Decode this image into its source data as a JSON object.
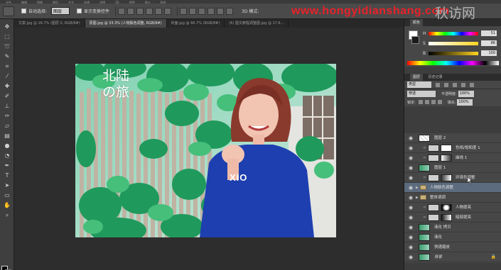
{
  "app": {
    "menu": [
      "文件",
      "编辑",
      "图像",
      "图层",
      "文字",
      "选择",
      "滤镜",
      "3D",
      "视图",
      "窗口",
      "帮助"
    ]
  },
  "options_bar": {
    "auto_select_label": "自动选择:",
    "auto_select_value": "图层",
    "show_transform_label": "显示变换控件",
    "mode_3d_label": "3D 模式:"
  },
  "watermark": {
    "url": "www.hongyidianshang.com",
    "brand": "秋访网"
  },
  "tabs": [
    {
      "label": "文案.jpg @ 16.7% (图层 0, RGB/8#)",
      "active": false
    },
    {
      "label": "原图.jpg @ 33.3% (人物肤色调整, RGB/8#)",
      "active": true
    },
    {
      "label": "封面.jpg @ 66.7% (RGB/8#)",
      "active": false
    },
    {
      "label": "(6) 图文教程调整图.jpg @ 17.6...",
      "active": false
    }
  ],
  "canvas": {
    "title_text": "北陆の旅",
    "shirt_text": "XIO"
  },
  "color_panel": {
    "tab_label": "颜色",
    "sliders": [
      {
        "label": "H",
        "value": "51"
      },
      {
        "label": "S",
        "value": "86"
      },
      {
        "label": "B",
        "value": "100"
      }
    ]
  },
  "layers_panel": {
    "tabs": [
      "图层",
      "历史记录"
    ],
    "filter_type": "类型",
    "blend_mode": "穿透",
    "opacity_label": "不透明度:",
    "opacity_value": "100%",
    "lock_label": "锁定:",
    "fill_label": "填充:",
    "fill_value": "100%",
    "layers": [
      {
        "name": "图层 2",
        "kind": "pixel",
        "selected": false
      },
      {
        "name": "色相/饱和度 1",
        "kind": "adjustment",
        "selected": false
      },
      {
        "name": "曲线 1",
        "kind": "adjustment",
        "selected": false
      },
      {
        "name": "图层 1",
        "kind": "pixel",
        "selected": false
      },
      {
        "name": "环境色调整",
        "kind": "adjustment",
        "selected": false
      },
      {
        "name": "人物肤色调整",
        "kind": "group",
        "selected": true
      },
      {
        "name": "整体调调",
        "kind": "group",
        "selected": false
      },
      {
        "name": "人物提亮",
        "kind": "adjustment",
        "selected": false
      },
      {
        "name": "暗部提亮",
        "kind": "adjustment",
        "selected": false
      },
      {
        "name": "液化 拷贝",
        "kind": "pixel",
        "selected": false
      },
      {
        "name": "液化",
        "kind": "pixel",
        "selected": false
      },
      {
        "name": "快速磨皮",
        "kind": "pixel",
        "selected": false
      },
      {
        "name": "背景",
        "kind": "background",
        "selected": false
      }
    ]
  }
}
